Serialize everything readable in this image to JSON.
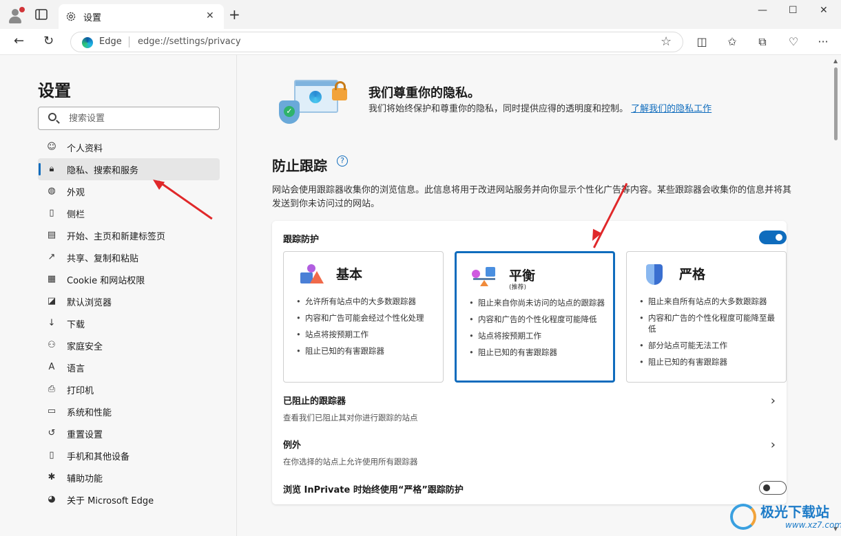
{
  "browser": {
    "tab_title": "设置",
    "site_name": "Edge",
    "url": "edge://settings/privacy"
  },
  "sidebar": {
    "title": "设置",
    "search_placeholder": "搜索设置",
    "items": [
      {
        "label": "个人资料",
        "icon": "profile-icon"
      },
      {
        "label": "隐私、搜索和服务",
        "icon": "lock-icon",
        "active": true
      },
      {
        "label": "外观",
        "icon": "palette-icon"
      },
      {
        "label": "侧栏",
        "icon": "sidebar-icon"
      },
      {
        "label": "开始、主页和新建标签页",
        "icon": "home-icon"
      },
      {
        "label": "共享、复制和粘贴",
        "icon": "share-icon"
      },
      {
        "label": "Cookie 和网站权限",
        "icon": "cookie-icon"
      },
      {
        "label": "默认浏览器",
        "icon": "browser-icon"
      },
      {
        "label": "下载",
        "icon": "download-icon"
      },
      {
        "label": "家庭安全",
        "icon": "family-icon"
      },
      {
        "label": "语言",
        "icon": "language-icon"
      },
      {
        "label": "打印机",
        "icon": "printer-icon"
      },
      {
        "label": "系统和性能",
        "icon": "laptop-icon"
      },
      {
        "label": "重置设置",
        "icon": "reset-icon"
      },
      {
        "label": "手机和其他设备",
        "icon": "phone-icon"
      },
      {
        "label": "辅助功能",
        "icon": "accessibility-icon"
      },
      {
        "label": "关于 Microsoft Edge",
        "icon": "edge-logo-icon"
      }
    ]
  },
  "hero": {
    "title": "我们尊重你的隐私。",
    "description": "我们将始终保护和尊重你的隐私，同时提供应得的透明度和控制。",
    "link": "了解我们的隐私工作"
  },
  "tracking": {
    "section_title": "防止跟踪",
    "description": "网站会使用跟踪器收集你的浏览信息。此信息将用于改进网站服务并向你显示个性化广告等内容。某些跟踪器会收集你的信息并将其发送到你未访问过的网站。",
    "toggle_label": "跟踪防护",
    "toggle_on": true,
    "options": [
      {
        "name": "基本",
        "sub": "",
        "bullets": [
          "允许所有站点中的大多数跟踪器",
          "内容和广告可能会经过个性化处理",
          "站点将按预期工作",
          "阻止已知的有害跟踪器"
        ]
      },
      {
        "name": "平衡",
        "sub": "(推荐)",
        "selected": true,
        "bullets": [
          "阻止来自你尚未访问的站点的跟踪器",
          "内容和广告的个性化程度可能降低",
          "站点将按预期工作",
          "阻止已知的有害跟踪器"
        ]
      },
      {
        "name": "严格",
        "sub": "",
        "bullets": [
          "阻止来自所有站点的大多数跟踪器",
          "内容和广告的个性化程度可能降至最低",
          "部分站点可能无法工作",
          "阻止已知的有害跟踪器"
        ]
      }
    ],
    "blocked": {
      "title": "已阻止的跟踪器",
      "desc": "查看我们已阻止其对你进行跟踪的站点"
    },
    "exceptions": {
      "title": "例外",
      "desc": "在你选择的站点上允许使用所有跟踪器"
    },
    "inprivate": {
      "title": "浏览 InPrivate 时始终使用“严格”跟踪防护",
      "toggle_on": false
    }
  },
  "watermark": {
    "name": "极光下载站",
    "url": "www.xz7.com"
  },
  "colors": {
    "accent": "#0f6cbd",
    "annotation": "#e0282a"
  }
}
